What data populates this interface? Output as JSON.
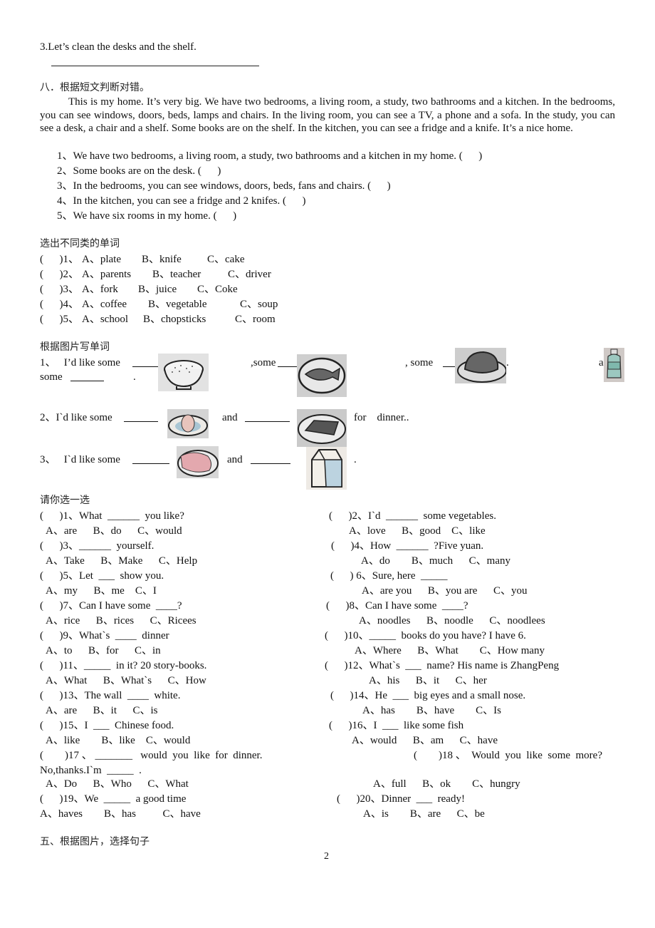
{
  "prev_item": {
    "text": "3.Let’s clean the desks and the shelf."
  },
  "section8": {
    "title": "八．根据短文判断对错。",
    "passage": "This is my home. It’s very big. We have two bedrooms, a living room, a study, two bathrooms and a kitchen. In the bedrooms, you can see windows, doors, beds, lamps and chairs. In the living room, you can see a TV, a phone and a sofa. In the study, you can see a desk, a chair and a shelf. Some books are on the shelf. In the kitchen, you can see a fridge and a knife. It’s a nice home.",
    "statements": [
      "1、We have two bedrooms, a living room, a study, two bathrooms and a kitchen in my home. (      )",
      "2、Some books are on the desk. (      )",
      "3、In the bedrooms, you can see windows, doors, beds, fans and chairs. (      )",
      "4、In the kitchen, you can see a fridge and 2 knifes. (      )",
      "5、We have six rooms in my home. (      )"
    ]
  },
  "odd_one_out": {
    "title": "选出不同类的单词",
    "items": [
      {
        "bracket": "(      )1、",
        "a": "A、plate",
        "b": "B、knife",
        "c": "C、cake"
      },
      {
        "bracket": "(      )2、",
        "a": "A、parents",
        "b": "B、teacher",
        "c": "C、driver"
      },
      {
        "bracket": "(      )3、",
        "a": "A、fork",
        "b": "B、juice",
        "c": "C、Coke"
      },
      {
        "bracket": "(      )4、",
        "a": "A、coffee",
        "b": "B、vegetable",
        "c": "C、soup"
      },
      {
        "bracket": "(      )5、",
        "a": "A、school",
        "b": "B、chopsticks",
        "c": "C、room"
      }
    ]
  },
  "picture_words": {
    "title": "根据图片写单词",
    "q1": {
      "lead": "1、   I’d like some",
      "mid1": ",some",
      "mid2": ", some",
      "end_dot": ".",
      "tail": "a",
      "line2_lead": "some",
      "line2_end": "."
    },
    "q2": {
      "lead": "2、I`d like some",
      "and": "and",
      "tail": "for    dinner.."
    },
    "q3": {
      "lead": "3、   I`d like some",
      "and": "and",
      "end": "."
    },
    "pictures": [
      "rice-bowl",
      "fish-plate",
      "chicken-plate",
      "water-bottle",
      "egg-plate",
      "beef-plate",
      "ham-plate",
      "milk-carton"
    ]
  },
  "choose": {
    "title": "请你选一选",
    "left": [
      {
        "q": "(      )1、What  ______  you like?",
        "opts": "A、are      B、do      C、would"
      },
      {
        "q": "(      )3、______  yourself.",
        "opts": "A、Take      B、Make      C、Help"
      },
      {
        "q": "(      )5、Let  ___  show you.",
        "opts": "A、my      B、me    C、I"
      },
      {
        "q": "(      )7、Can I have some  ____?",
        "opts": "A、rice      B、rices      C、Ricees"
      },
      {
        "q": "(      )9、What`s  ____  dinner",
        "opts": "A、to      B、for      C、in"
      },
      {
        "q": "(      )11、_____  in it? 20 story-books.",
        "opts": "A、What      B、What`s      C、How"
      },
      {
        "q": "(      )13、The wall  ____  white.",
        "opts": "A、are      B、it      C、is"
      },
      {
        "q": "(      )15、I  ___  Chinese food.",
        "opts": "A、like        B、like    C、would"
      }
    ],
    "right": [
      {
        "q": "(      )2、I`d  ______  some vegetables.",
        "opts": "A、love      B、good    C、like"
      },
      {
        "q": "(      )4、How  ______  ?Five yuan.",
        "opts": "A、do        B、much      C、many"
      },
      {
        "q": "(      ) 6、Sure, here  _____",
        "opts": "A、are you      B、you are      C、you"
      },
      {
        "q": "(      )8、Can I have some  ____?",
        "opts": "A、noodles      B、noodle      C、noodlees"
      },
      {
        "q": "(      )10、_____  books do you have? I have 6.",
        "opts": "A、Where      B、What        C、How many"
      },
      {
        "q": "(      )12、What`s  ___  name? His name is ZhangPeng",
        "opts": "A、his      B、it      C、her"
      },
      {
        "q": "(      )14、He  ___  big eyes and a small nose.",
        "opts": "A、has        B、have        C、Is"
      },
      {
        "q": "(      )16、I  ___  like some fish",
        "opts": "A、would      B、am      C、have"
      }
    ],
    "q17": {
      "line1": "(        )17 、 _______   would  you  like  for  dinner.",
      "line2": "No,thanks.I`m  _____  .",
      "opts": "A、Do      B、Who      C、What"
    },
    "q18": {
      "line1": "(        )18 、  Would  you  like  some  more?",
      "opts": "A、full      B、ok        C、hungry"
    },
    "q19": {
      "q": "(      )19、We  _____  a good time",
      "opts": "A、haves        B、has          C、have"
    },
    "q20": {
      "q": "(      )20、Dinner  ___  ready!",
      "opts": "A、is        B、are      C、be"
    }
  },
  "section5": {
    "title": "五、根据图片，选择句子"
  },
  "page_number": "2"
}
